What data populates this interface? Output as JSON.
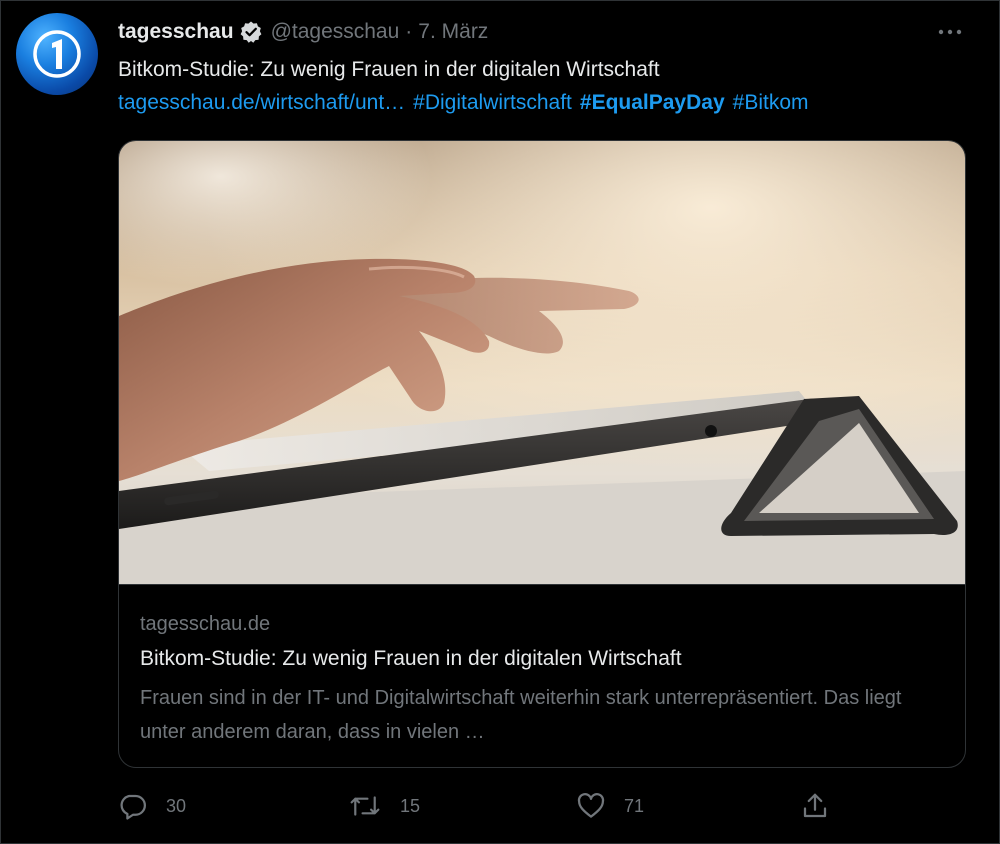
{
  "tweet": {
    "author_name": "tagesschau",
    "handle": "@tagesschau",
    "separator": "·",
    "date": "7. März",
    "text": "Bitkom-Studie: Zu wenig Frauen in der digitalen Wirtschaft",
    "links": [
      {
        "text": "tagesschau.de/wirtschaft/unt…",
        "bold": false
      },
      {
        "text": "#Digitalwirtschaft",
        "bold": false
      },
      {
        "text": "#EqualPayDay",
        "bold": true
      },
      {
        "text": "#Bitkom",
        "bold": false
      }
    ]
  },
  "card": {
    "domain": "tagesschau.de",
    "title": "Bitkom-Studie: Zu wenig Frauen in der digitalen Wirtschaft",
    "description": "Frauen sind in der IT- und Digitalwirtschaft weiterhin stark unterrepräsentiert. Das liegt unter anderem daran, dass in vielen …"
  },
  "actions": {
    "replies": "30",
    "retweets": "15",
    "likes": "71"
  },
  "colors": {
    "accent": "#1d9bf0",
    "muted": "#71767b",
    "text": "#e7e9ea",
    "border": "#2f3336"
  }
}
